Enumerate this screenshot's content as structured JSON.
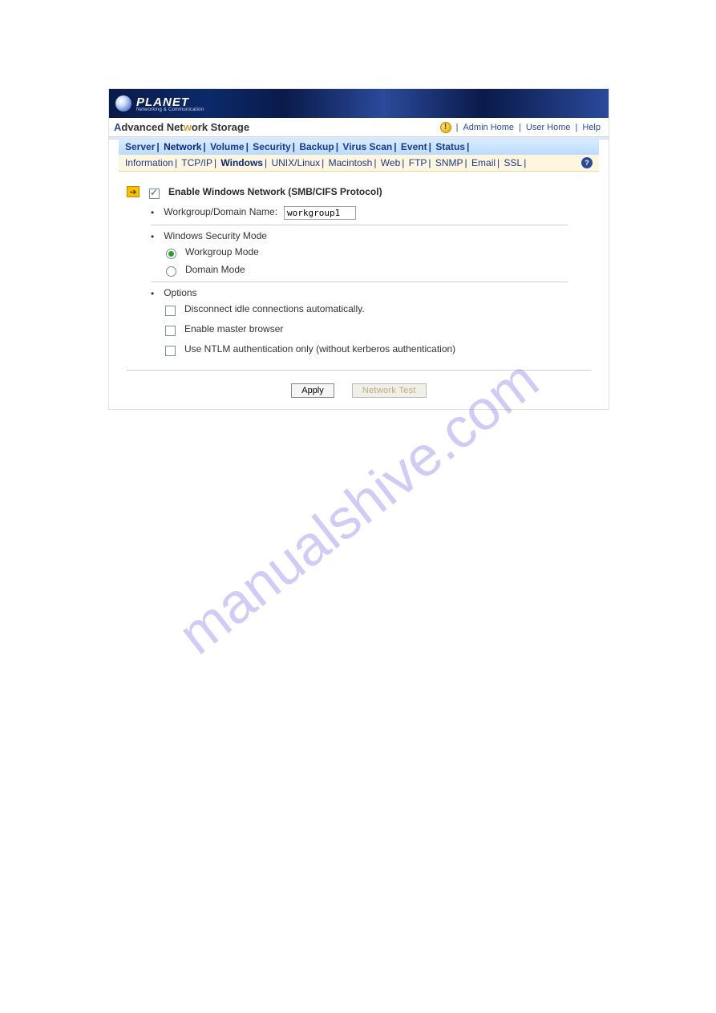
{
  "watermark": "manualshive.com",
  "brand": {
    "name": "PLANET",
    "tagline": "Networking & Communication"
  },
  "titlebar": {
    "title_prefix": "A",
    "title_mid": "dvanced Net",
    "title_accent": "w",
    "title_end": "ork Storage",
    "links": {
      "admin": "Admin Home",
      "user": "User Home",
      "help": "Help"
    }
  },
  "tabs_primary": [
    "Server",
    "Network",
    "Volume",
    "Security",
    "Backup",
    "Virus Scan",
    "Event",
    "Status"
  ],
  "tabs_primary_current": "Network",
  "tabs_secondary": [
    "Information",
    "TCP/IP",
    "Windows",
    "UNIX/Linux",
    "Macintosh",
    "Web",
    "FTP",
    "SNMP",
    "Email",
    "SSL"
  ],
  "tabs_secondary_current": "Windows",
  "form": {
    "enable_label": "Enable Windows Network (SMB/CIFS Protocol)",
    "enable_checked": true,
    "workgroup_label": "Workgroup/Domain Name:",
    "workgroup_value": "workgroup1",
    "sec_mode_label": "Windows Security Mode",
    "mode_workgroup": "Workgroup Mode",
    "mode_domain": "Domain Mode",
    "mode_selected": "workgroup",
    "options_label": "Options",
    "opt1": "Disconnect idle connections automatically.",
    "opt2": "Enable master browser",
    "opt3": "Use NTLM authentication only (without kerberos authentication)",
    "btn_apply": "Apply",
    "btn_test": "Network Test"
  }
}
